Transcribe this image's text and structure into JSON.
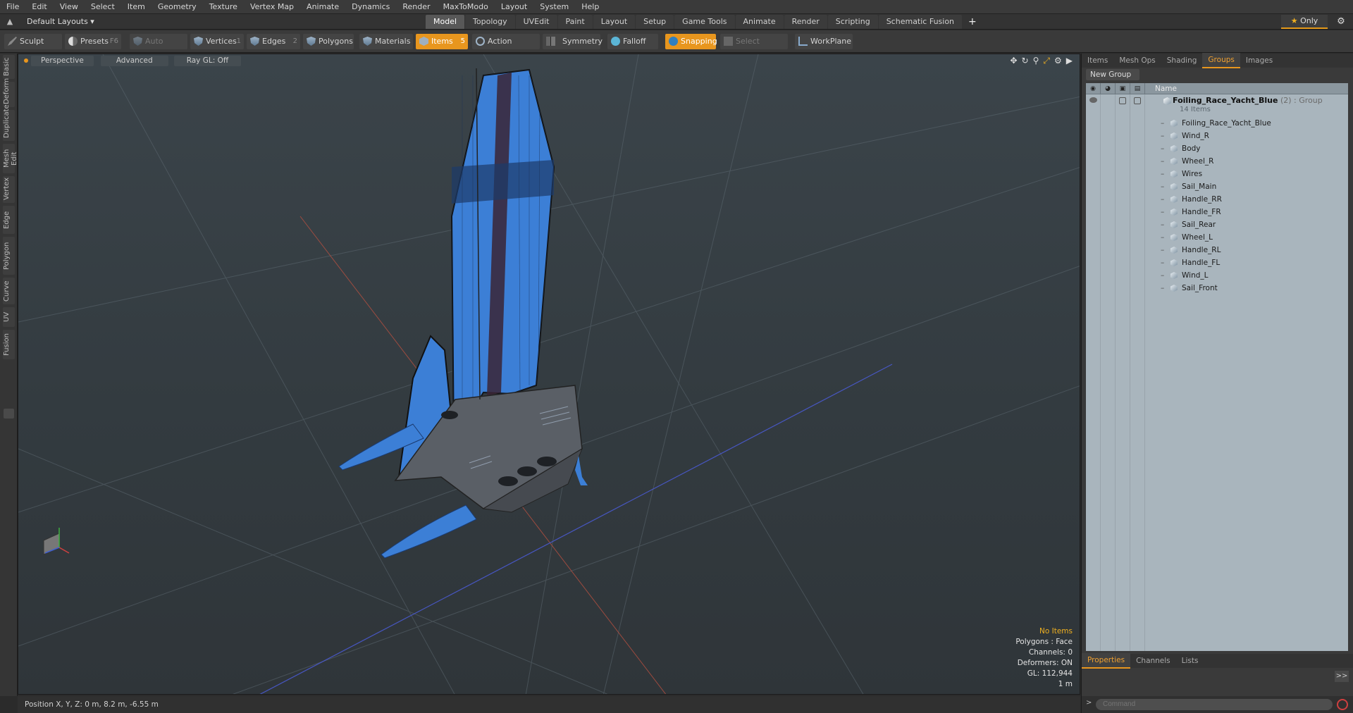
{
  "menu": [
    "File",
    "Edit",
    "View",
    "Select",
    "Item",
    "Geometry",
    "Texture",
    "Vertex Map",
    "Animate",
    "Dynamics",
    "Render",
    "MaxToModo",
    "Layout",
    "System",
    "Help"
  ],
  "layout_select": "Default Layouts ▾",
  "layout_tabs": [
    {
      "label": "Model",
      "active": true
    },
    {
      "label": "Topology"
    },
    {
      "label": "UVEdit"
    },
    {
      "label": "Paint"
    },
    {
      "label": "Layout"
    },
    {
      "label": "Setup"
    },
    {
      "label": "Game Tools"
    },
    {
      "label": "Animate"
    },
    {
      "label": "Render"
    },
    {
      "label": "Scripting"
    },
    {
      "label": "Schematic Fusion"
    }
  ],
  "only_label": "Only",
  "toolbar": {
    "sculpt": "Sculpt",
    "presets": "Presets",
    "presets_key": "F6",
    "auto_select": "Auto Select",
    "vertices": "Vertices",
    "vertices_key": "1",
    "edges": "Edges",
    "edges_key": "2",
    "polygons": "Polygons",
    "materials": "Materials",
    "items": "Items",
    "items_key": "5",
    "action_center": "Action Center",
    "symmetry": "Symmetry",
    "falloff": "Falloff",
    "snapping": "Snapping",
    "select_through": "Select Through",
    "workplane": "WorkPlane"
  },
  "left_tabs": [
    "Basic",
    "Deform",
    "Duplicate",
    "Mesh Edit",
    "Vertex",
    "Edge",
    "Polygon",
    "Curve",
    "UV",
    "Fusion"
  ],
  "viewport": {
    "view_mode": "Perspective",
    "shading": "Advanced",
    "raygl": "Ray GL: Off",
    "info": {
      "selection": "No Items",
      "polygons": "Polygons : Face",
      "channels": "Channels: 0",
      "deformers": "Deformers: ON",
      "gl": "GL: 112,944",
      "scale": "1 m"
    }
  },
  "status": "Position X, Y, Z:   0 m, 8.2 m, -6.55 m",
  "right_panel": {
    "tabs": [
      {
        "label": "Items"
      },
      {
        "label": "Mesh Ops"
      },
      {
        "label": "Shading"
      },
      {
        "label": "Groups",
        "active": true
      },
      {
        "label": "Images"
      }
    ],
    "new_group": "New Group",
    "name_header": "Name",
    "group": {
      "name": "Foiling_Race_Yacht_Blue",
      "suffix": " (2) : Group",
      "count": "14 Items"
    },
    "items": [
      "Foiling_Race_Yacht_Blue",
      "Wind_R",
      "Body",
      "Wheel_R",
      "Wires",
      "Sail_Main",
      "Handle_RR",
      "Handle_FR",
      "Sail_Rear",
      "Wheel_L",
      "Handle_RL",
      "Handle_FL",
      "Wind_L",
      "Sail_Front"
    ],
    "bottom_tabs": [
      {
        "label": "Properties",
        "active": true
      },
      {
        "label": "Channels"
      },
      {
        "label": "Lists"
      }
    ],
    "command_placeholder": "Command"
  },
  "colors": {
    "accent": "#e8961e",
    "sail_blue": "#3d7fd6",
    "list_bg": "#a9b5bd"
  }
}
